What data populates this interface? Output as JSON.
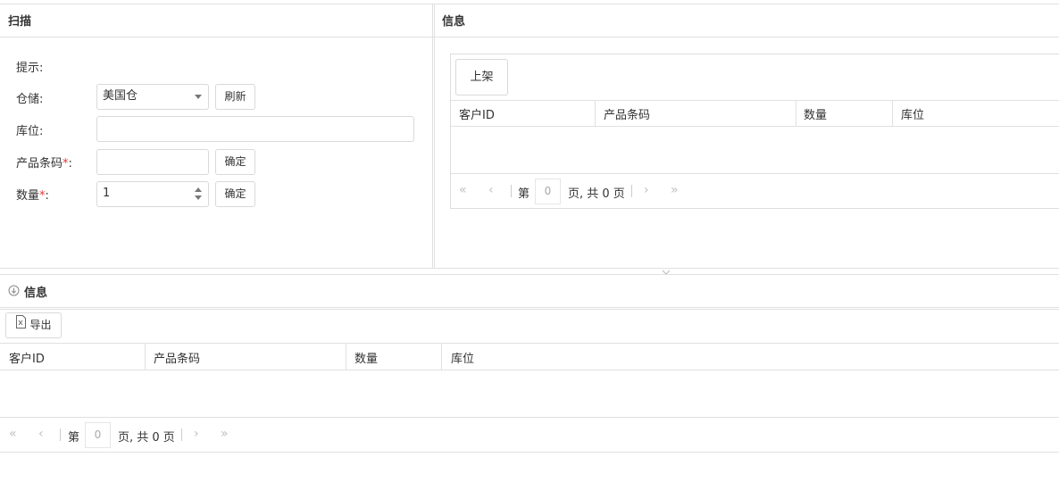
{
  "scan_panel": {
    "title": "扫描",
    "hint_label": "提示:",
    "warehouse_label": "仓储:",
    "warehouse_value": "美国仓",
    "refresh_label": "刷新",
    "location_label": "库位:",
    "location_value": "",
    "barcode_label": "产品条码",
    "barcode_value": "",
    "confirm_label": "确定",
    "quantity_label": "数量",
    "quantity_value": "1",
    "required_mark": "*",
    "colon": ":"
  },
  "info_panel_top": {
    "title": "信息",
    "shelve_button": "上架",
    "columns": [
      "客户ID",
      "产品条码",
      "数量",
      "库位"
    ],
    "pager": {
      "page_prefix": "第",
      "page_value": "0",
      "page_suffix": "页, 共 0 页"
    }
  },
  "info_panel_bottom": {
    "title": "信息",
    "export_button": "导出",
    "columns": [
      "客户ID",
      "产品条码",
      "数量",
      "库位"
    ],
    "pager": {
      "page_prefix": "第",
      "page_value": "0",
      "page_suffix": "页, 共 0 页"
    }
  },
  "icons": {
    "collapse": "chevron-down-circle-icon",
    "export": "excel-file-icon",
    "dropdown": "caret-down-icon",
    "spinner": "spinner-arrows-icon"
  }
}
